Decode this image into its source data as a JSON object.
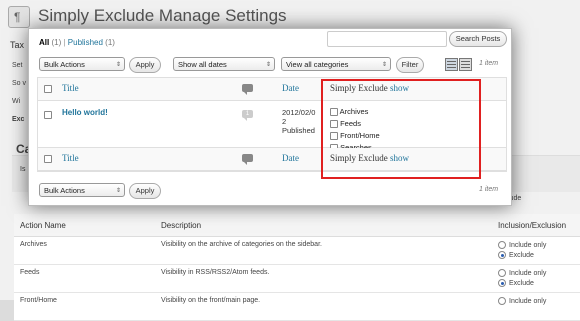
{
  "settings_page": {
    "title": "Simply Exclude Manage Settings",
    "section_taxonomy": "Tax",
    "side_labels": [
      "Set",
      "So v",
      "Wi",
      "Exc"
    ],
    "section_categories": "Ca",
    "row_label": "Is",
    "right_stub": [
      "e",
      "lude"
    ],
    "table": {
      "headers": [
        "Action Name",
        "Description",
        "Inclusion/Exclusion"
      ],
      "rows": [
        {
          "name": "Archives",
          "description": "Visibility on the archive of categories on the sidebar.",
          "options": [
            "Include only",
            "Exclude"
          ],
          "selected": "Exclude"
        },
        {
          "name": "Feeds",
          "description": "Visibility in RSS/RSS2/Atom feeds.",
          "options": [
            "Include only",
            "Exclude"
          ],
          "selected": "Exclude"
        },
        {
          "name": "Front/Home",
          "description": "Visibility on the front/main page.",
          "options": [
            "Include only"
          ],
          "selected": ""
        }
      ]
    }
  },
  "modal": {
    "filters": {
      "all_label": "All",
      "all_count": "(1)",
      "separator": "|",
      "published_label": "Published",
      "published_count": "(1)"
    },
    "search_button": "Search Posts",
    "bulk_actions": "Bulk Actions",
    "apply": "Apply",
    "dates": "Show all dates",
    "categories": "View all categories",
    "filter": "Filter",
    "item_count": "1 item",
    "columns": {
      "title": "Title",
      "date": "Date",
      "simply_exclude": "Simply Exclude",
      "show": "show"
    },
    "post": {
      "title": "Hello world!",
      "comments": "1",
      "date_lines": [
        "2012/02/0",
        "2",
        "Published"
      ],
      "exclude_options": [
        "Archives",
        "Feeds",
        "Front/Home",
        "Searches"
      ]
    }
  },
  "colors": {
    "link": "#21759b",
    "highlight": "#e02020",
    "radio_selected": "#2a5db0"
  }
}
